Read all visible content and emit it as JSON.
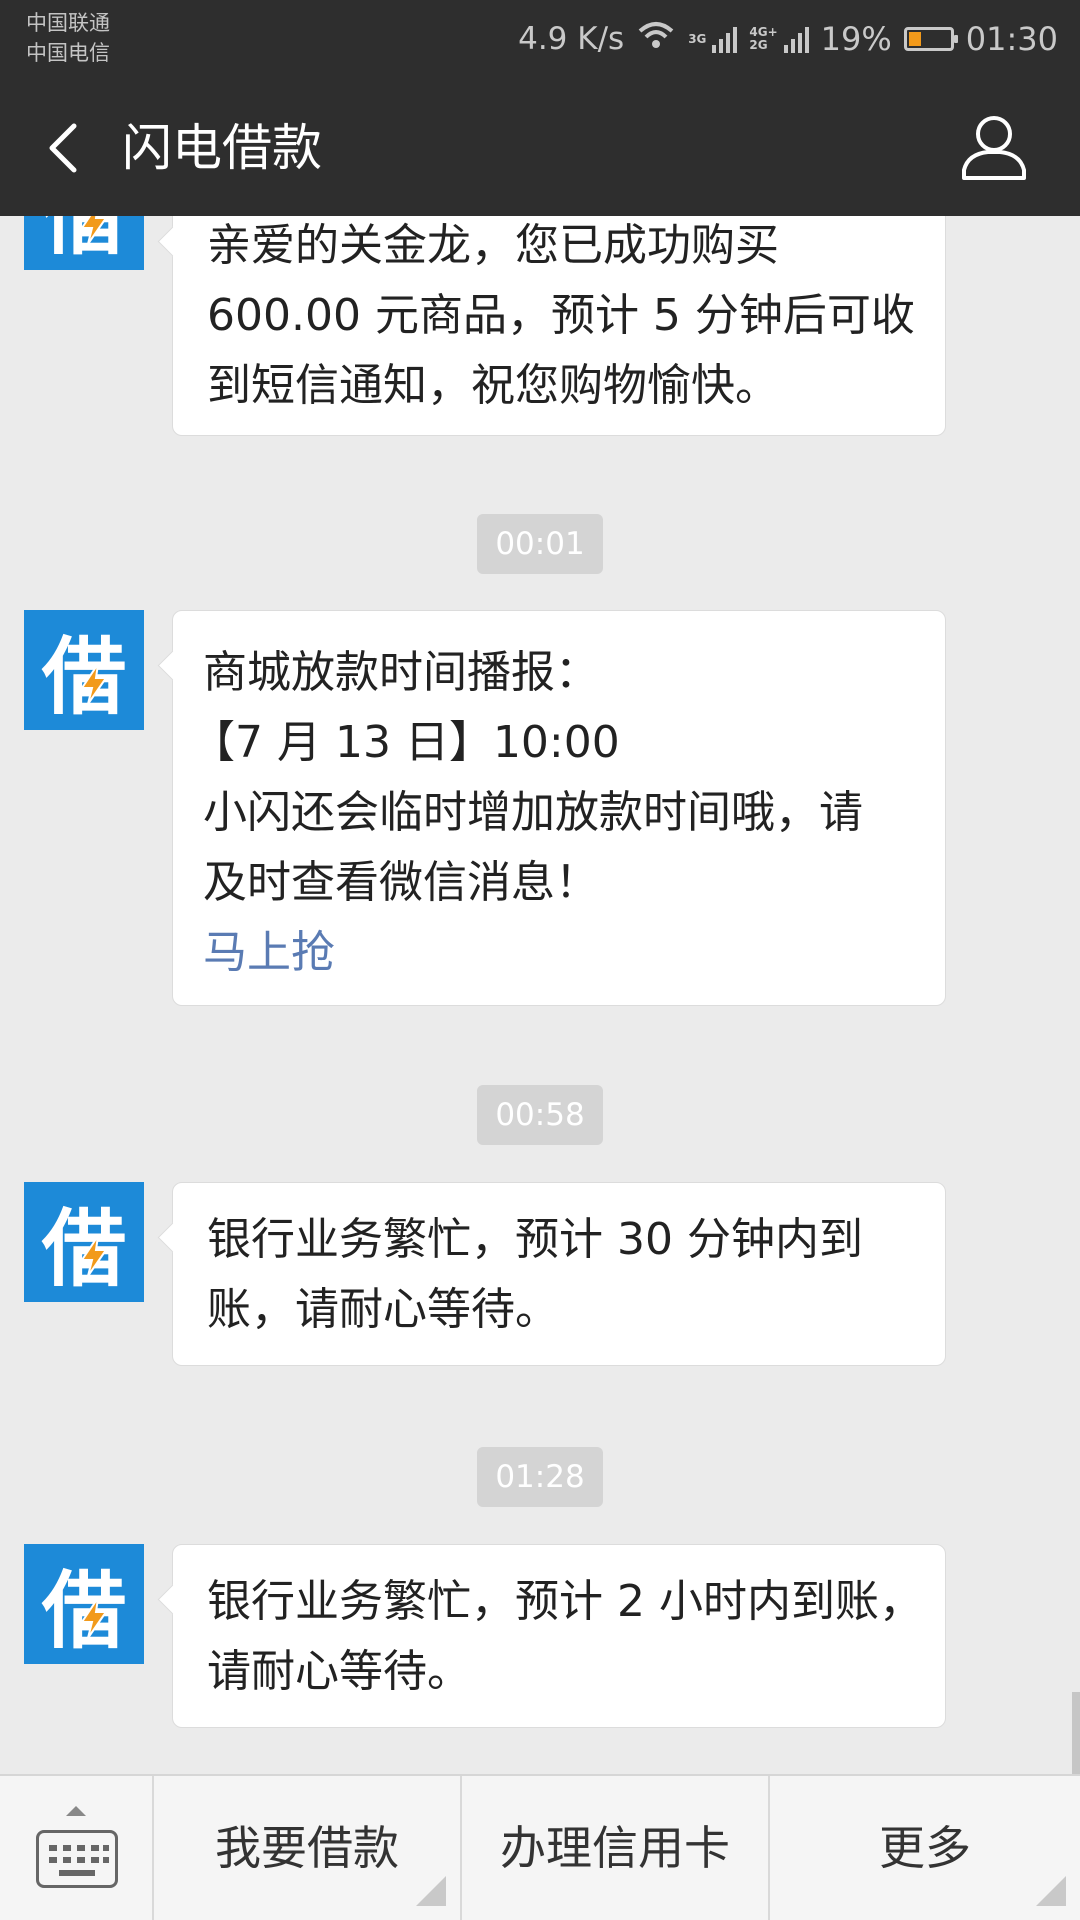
{
  "status_bar": {
    "carrier_1": "中国联通",
    "carrier_2": "中国电信",
    "speed": "4.9 K/s",
    "network_1": "3G",
    "network_2a": "4G+",
    "network_2b": "2G",
    "battery_percent": "19%",
    "battery_level": 0.19,
    "battery_color": "#f29a1b",
    "time": "01:30"
  },
  "nav": {
    "back_icon": "chevron-left-icon",
    "title": "闪电借款",
    "profile_icon": "person-icon"
  },
  "brand": {
    "avatar_char": "借",
    "avatar_color": "#1d8ad8",
    "bolt_color": "#f29a1b"
  },
  "messages": [
    {
      "type": "text",
      "lines": [
        "亲爱的关金龙，您已成功购买",
        "600.00 元商品，预计 5 分钟后可收",
        "到短信通知，祝您购物愉快。"
      ]
    },
    {
      "type": "time",
      "text": "00:01"
    },
    {
      "type": "text",
      "lines": [
        "商城放款时间播报：",
        "【7 月 13 日】10:00",
        "小闪还会临时增加放款时间哦，请",
        "及时查看微信消息！"
      ],
      "link": "马上抢"
    },
    {
      "type": "time",
      "text": "00:58"
    },
    {
      "type": "text",
      "lines": [
        "银行业务繁忙，预计 30 分钟内到",
        "账，请耐心等待。"
      ]
    },
    {
      "type": "time",
      "text": "01:28"
    },
    {
      "type": "text",
      "lines": [
        "银行业务繁忙，预计 2 小时内到账，",
        "请耐心等待。"
      ]
    }
  ],
  "bottom_menu": {
    "keyboard_icon": "keyboard-icon",
    "items": [
      "我要借款",
      "办理信用卡",
      "更多"
    ]
  },
  "colors": {
    "bar_bg": "#2e2e2e",
    "chat_bg": "#ebebeb",
    "link": "#5a7bb3"
  }
}
